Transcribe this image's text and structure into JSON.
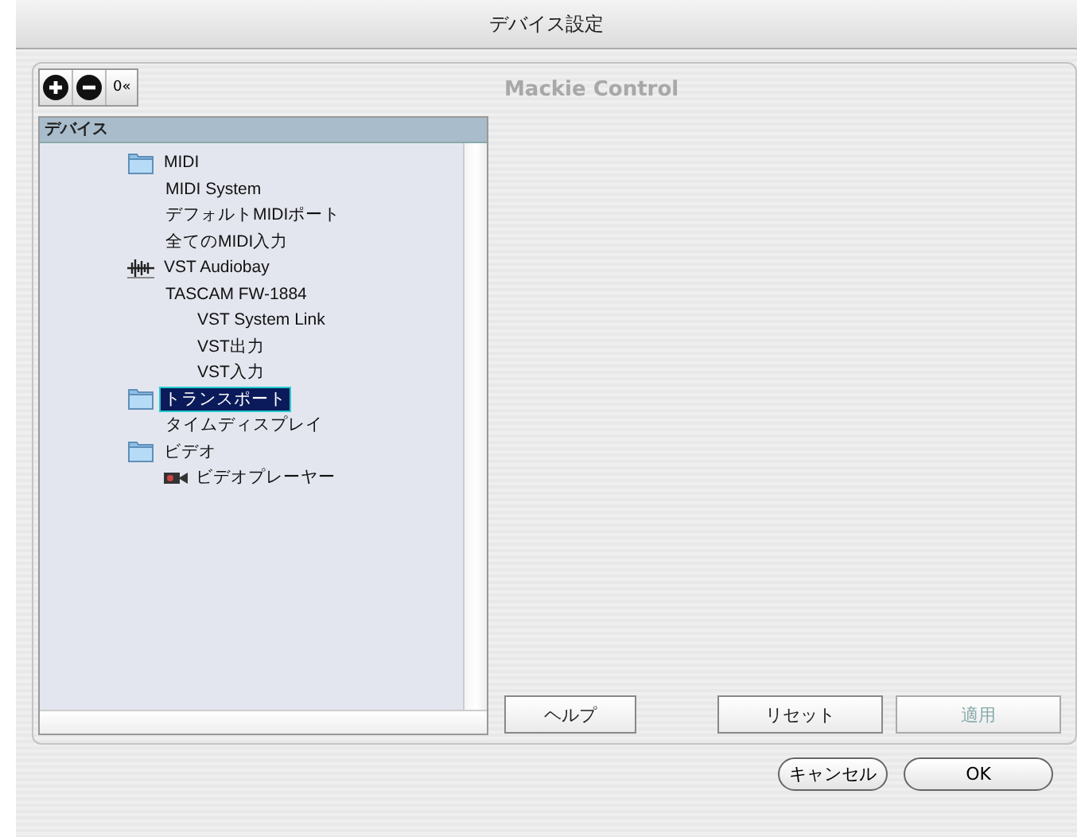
{
  "window": {
    "title": "デバイス設定"
  },
  "toolbar": [
    {
      "kind": "add"
    },
    {
      "kind": "remove"
    },
    {
      "kind": "reset",
      "label": "0«"
    }
  ],
  "list": {
    "header": "デバイス",
    "items": [
      {
        "label": "MIDI",
        "kind": "folder",
        "selected": false,
        "children": [
          {
            "label": "MIDI System",
            "selected": false
          },
          {
            "label": "デフォルトMIDIポート",
            "selected": false
          },
          {
            "label": "全てのMIDI入力",
            "selected": false
          }
        ]
      },
      {
        "label": "VST Audiobay",
        "kind": "audio",
        "selected": false,
        "children": [
          {
            "label": "TASCAM FW-1884",
            "selected": false,
            "children": [
              {
                "label": "VST System Link",
                "selected": false
              },
              {
                "label": "VST出力",
                "selected": false
              },
              {
                "label": "VST入力",
                "selected": false
              }
            ]
          }
        ]
      },
      {
        "label": "トランスポート",
        "kind": "folder",
        "selected": true,
        "children": [
          {
            "label": "タイムディスプレイ",
            "selected": false
          }
        ]
      },
      {
        "label": "ビデオ",
        "kind": "folder",
        "selected": false,
        "children": [
          {
            "label": "ビデオプレーヤー",
            "kind": "video",
            "selected": false
          }
        ]
      }
    ]
  },
  "panel": {
    "title": "Mackie Control"
  },
  "panel_buttons": [
    {
      "label": "ヘルプ",
      "disabled": false
    },
    {
      "label": "リセット",
      "disabled": false
    },
    {
      "label": "適用",
      "disabled": true
    }
  ],
  "dialog_buttons": [
    {
      "label": "キャンセル"
    },
    {
      "label": "OK"
    }
  ]
}
